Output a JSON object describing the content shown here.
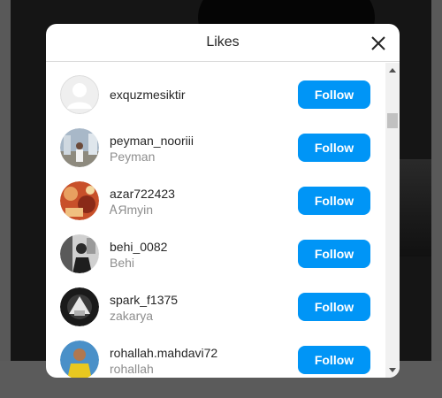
{
  "dialog": {
    "title": "Likes",
    "close_icon": "close-icon"
  },
  "likes": [
    {
      "username": "exquzmesiktir",
      "full_name": "",
      "button": "Follow",
      "avatar": "default-avatar-icon"
    },
    {
      "username": "peyman_nooriii",
      "full_name": "Peyman",
      "button": "Follow",
      "avatar": "user-photo"
    },
    {
      "username": "azar722423",
      "full_name": "ᎪЯmyin",
      "button": "Follow",
      "avatar": "user-photo"
    },
    {
      "username": "behi_0082",
      "full_name": "Behi",
      "button": "Follow",
      "avatar": "user-photo"
    },
    {
      "username": "spark_f1375",
      "full_name": "zakarya",
      "button": "Follow",
      "avatar": "user-photo"
    },
    {
      "username": "rohallah.mahdavi72",
      "full_name": "rohallah",
      "button": "Follow",
      "avatar": "user-photo"
    }
  ],
  "colors": {
    "accent": "#0095f6",
    "text_primary": "#262626",
    "text_secondary": "#8e8e8e"
  }
}
